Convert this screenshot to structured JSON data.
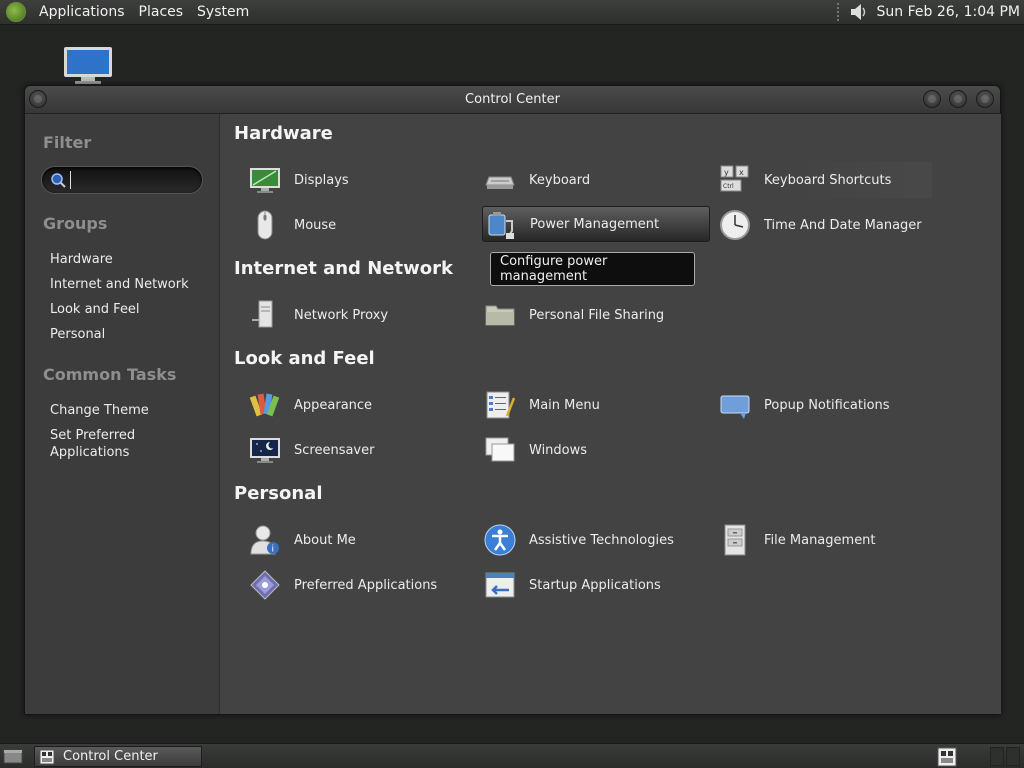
{
  "top_panel": {
    "menus": [
      "Applications",
      "Places",
      "System"
    ],
    "clock": "Sun Feb 26, 1:04 PM"
  },
  "window": {
    "title": "Control Center"
  },
  "sidebar": {
    "filter_heading": "Filter",
    "search": {
      "value": "",
      "placeholder": ""
    },
    "groups_heading": "Groups",
    "groups": [
      "Hardware",
      "Internet and Network",
      "Look and Feel",
      "Personal"
    ],
    "tasks_heading": "Common Tasks",
    "tasks": [
      "Change Theme",
      "Set Preferred\nApplications"
    ]
  },
  "sections": [
    {
      "heading": "Hardware",
      "items": [
        "Displays",
        "Keyboard",
        "Keyboard Shortcuts",
        "Mouse",
        "Power Management",
        "Time And Date Manager"
      ]
    },
    {
      "heading": "Internet and Network",
      "items": [
        "Network Proxy",
        "Personal File Sharing"
      ]
    },
    {
      "heading": "Look and Feel",
      "items": [
        "Appearance",
        "Main Menu",
        "Popup Notifications",
        "Screensaver",
        "Windows"
      ]
    },
    {
      "heading": "Personal",
      "items": [
        "About Me",
        "Assistive Technologies",
        "File Management",
        "Preferred Applications",
        "Startup Applications"
      ]
    }
  ],
  "tooltip": "Configure power management",
  "taskbar": {
    "task_label": "Control Center"
  },
  "colors": {
    "desktop_bg": "#232523",
    "window_bg": "#424342",
    "sidebar_bg": "#3b3c3b",
    "accent_blue": "#3d7fd6"
  },
  "icons": {
    "displays": "monitor-icon",
    "keyboard": "keyboard-icon",
    "keyboard_shortcuts": "keyboard-shortcuts-icon",
    "mouse": "mouse-icon",
    "power": "power-management-icon",
    "time": "clock-icon",
    "network_proxy": "network-proxy-icon",
    "file_sharing": "folder-icon",
    "appearance": "appearance-icon",
    "main_menu": "main-menu-icon",
    "popup": "popup-notification-icon",
    "screensaver": "screensaver-icon",
    "windows": "windows-icon",
    "about_me": "user-icon",
    "assistive": "accessibility-icon",
    "file_management": "file-cabinet-icon",
    "preferred_apps": "preferred-apps-icon",
    "startup_apps": "startup-apps-icon"
  }
}
